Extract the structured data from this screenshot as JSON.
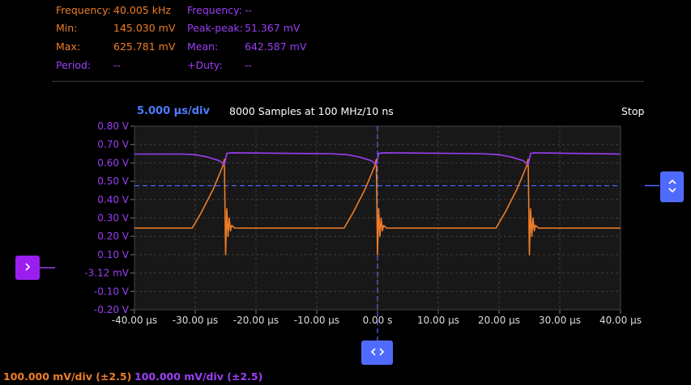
{
  "measurements": {
    "ch1_frequency_label": "Frequency:",
    "ch1_frequency_value": "40.005 kHz",
    "ch2_frequency_label": "Frequency:",
    "ch2_frequency_value": "--",
    "min_label": "Min:",
    "min_value": "145.030 mV",
    "peak_label": "Peak-peak:",
    "peak_value": "51.367 mV",
    "max_label": "Max:",
    "max_value": "625.781 mV",
    "mean_label": "Mean:",
    "mean_value": "642.587 mV",
    "period_label": "Period:",
    "period_value": "--",
    "duty_label": "+Duty:",
    "duty_value": "--"
  },
  "header": {
    "timebase": "5.000 µs/div",
    "samples": "8000 Samples at 100 MHz/10 ns",
    "status": "Stop"
  },
  "colors": {
    "ch1": "#ef7d27",
    "ch2": "#9b3ff5",
    "accent": "#4f6bff",
    "grid_bg": "#181818"
  },
  "icons": {
    "trigger_level": "chevron-up-down-icon",
    "trigger_position": "chevron-left-right-icon",
    "channel_marker": "chevron-right-icon"
  },
  "chart_data": {
    "type": "line",
    "xlim": [
      -40,
      40
    ],
    "ylim": [
      -0.2,
      0.8
    ],
    "x_ticks": [
      "-40.00 µs",
      "-30.00 µs",
      "-20.00 µs",
      "-10.00 µs",
      "0.00 s",
      "10.00 µs",
      "20.00 µs",
      "30.00 µs",
      "40.00 µs"
    ],
    "y_ticks": [
      "0.80 V",
      "0.70 V",
      "0.60 V",
      "0.50 V",
      "0.40 V",
      "0.30 V",
      "0.20 V",
      "0.10 V",
      "-3.12 mV",
      "-0.10 V",
      "-0.20 V"
    ],
    "trigger_level_v": 0.476,
    "trigger_time_us": 0,
    "series": [
      {
        "color": "#ef7d27",
        "points": [
          [
            -40,
            0.245
          ],
          [
            -30.5,
            0.245
          ],
          [
            -29,
            0.33
          ],
          [
            -27,
            0.46
          ],
          [
            -25.5,
            0.58
          ],
          [
            -25.2,
            0.62
          ],
          [
            -25,
            0.1
          ],
          [
            -24.8,
            0.35
          ],
          [
            -24.6,
            0.2
          ],
          [
            -24.4,
            0.3
          ],
          [
            -24.2,
            0.23
          ],
          [
            -24,
            0.26
          ],
          [
            -23.5,
            0.245
          ],
          [
            -5.5,
            0.245
          ],
          [
            -4,
            0.33
          ],
          [
            -2,
            0.46
          ],
          [
            -0.5,
            0.58
          ],
          [
            -0.2,
            0.62
          ],
          [
            0,
            0.1
          ],
          [
            0.2,
            0.35
          ],
          [
            0.4,
            0.2
          ],
          [
            0.6,
            0.3
          ],
          [
            0.8,
            0.23
          ],
          [
            1,
            0.26
          ],
          [
            1.5,
            0.245
          ],
          [
            19.5,
            0.245
          ],
          [
            21,
            0.33
          ],
          [
            23,
            0.46
          ],
          [
            24.5,
            0.58
          ],
          [
            24.8,
            0.62
          ],
          [
            25,
            0.1
          ],
          [
            25.2,
            0.35
          ],
          [
            25.4,
            0.2
          ],
          [
            25.6,
            0.3
          ],
          [
            25.8,
            0.23
          ],
          [
            26,
            0.26
          ],
          [
            26.5,
            0.245
          ],
          [
            40,
            0.245
          ]
        ]
      },
      {
        "color": "#9b3ff5",
        "points": [
          [
            -40,
            0.648
          ],
          [
            -32,
            0.648
          ],
          [
            -30,
            0.645
          ],
          [
            -28,
            0.632
          ],
          [
            -26,
            0.612
          ],
          [
            -25.2,
            0.59
          ],
          [
            -24.8,
            0.652
          ],
          [
            -24,
            0.655
          ],
          [
            -8,
            0.65
          ],
          [
            -5,
            0.645
          ],
          [
            -3,
            0.632
          ],
          [
            -1,
            0.612
          ],
          [
            -0.2,
            0.59
          ],
          [
            0.2,
            0.652
          ],
          [
            1,
            0.655
          ],
          [
            17,
            0.65
          ],
          [
            20,
            0.645
          ],
          [
            22,
            0.632
          ],
          [
            24,
            0.612
          ],
          [
            24.8,
            0.59
          ],
          [
            25.2,
            0.652
          ],
          [
            26,
            0.655
          ],
          [
            40,
            0.648
          ]
        ]
      }
    ]
  },
  "footer": {
    "ch1_scale": "100.000 mV/div (±2.5)",
    "ch2_scale": "100.000 mV/div (±2.5)"
  }
}
